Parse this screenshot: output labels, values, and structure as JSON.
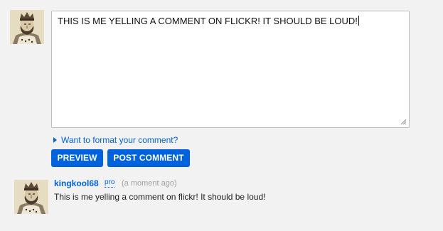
{
  "composer": {
    "avatar_icon": "king-portrait-avatar",
    "comment_value": "THIS IS ME YELLING A COMMENT ON FLICKR! IT SHOULD BE LOUD!",
    "format_link_label": "Want to format your comment?",
    "preview_label": "PREVIEW",
    "post_label": "POST COMMENT"
  },
  "comment": {
    "avatar_icon": "king-portrait-avatar",
    "author": "kingkool68",
    "badge": "pro",
    "timestamp": "(a moment ago)",
    "text": "This is me yelling a comment on flickr! It should be loud!"
  },
  "colors": {
    "accent": "#0063dc",
    "background": "#f2f2f2",
    "muted": "#a0a0a0"
  }
}
